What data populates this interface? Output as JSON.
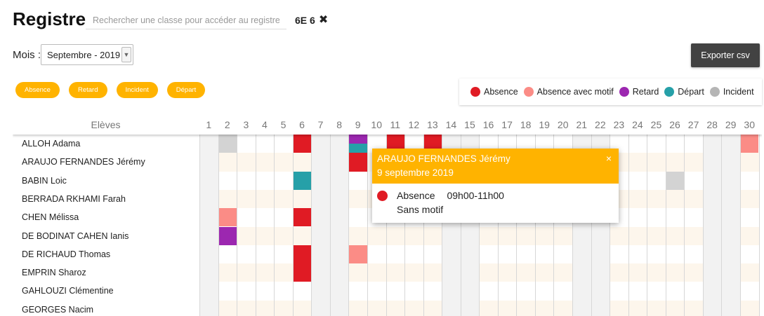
{
  "header": {
    "title": "Registre",
    "search_placeholder": "Rechercher une classe pour accéder au registre",
    "class_tag": "6E 6",
    "close_icon": "✖"
  },
  "controls": {
    "month_label": "Mois :",
    "month_value": "Septembre - 2019",
    "export_label": "Exporter csv"
  },
  "filters": [
    "Absence",
    "Retard",
    "Incident",
    "Départ"
  ],
  "colors": {
    "absence": "#e01b24",
    "absence_motif": "#fb8c86",
    "retard": "#9c27b0",
    "depart": "#26a0a8",
    "incident": "#d3d3d3",
    "accent": "#ffb300",
    "stripe": "#fdf6ec",
    "weekend": "#f2f2f2"
  },
  "legend": [
    {
      "label": "Absence",
      "color": "#e01b24"
    },
    {
      "label": "Absence avec motif",
      "color": "#fb8c86"
    },
    {
      "label": "Retard",
      "color": "#9c27b0"
    },
    {
      "label": "Départ",
      "color": "#26a0a8"
    },
    {
      "label": "Incident",
      "color": "#b5b5b5"
    }
  ],
  "grid": {
    "eleves_header": "Elèves",
    "days": [
      "1",
      "2",
      "3",
      "4",
      "5",
      "6",
      "7",
      "8",
      "9",
      "10",
      "11",
      "12",
      "13",
      "14",
      "15",
      "16",
      "17",
      "18",
      "19",
      "20",
      "21",
      "22",
      "23",
      "24",
      "25",
      "26",
      "27",
      "28",
      "29",
      "30"
    ],
    "weekend_days": [
      1,
      7,
      8,
      14,
      15,
      21,
      22,
      28,
      29
    ],
    "students": [
      "ALLOH Adama",
      "ARAUJO FERNANDES Jérémy",
      "BABIN Loic",
      "BERRADA RKHAMI Farah",
      "CHEN Mélissa",
      "DE BODINAT CAHEN Ianis",
      "DE RICHAUD Thomas",
      "EMPRIN Sharoz",
      "GAHLOUZI Clémentine",
      "GEORGES Nacim"
    ],
    "events": [
      {
        "student": 0,
        "day": 2,
        "type": "incident"
      },
      {
        "student": 0,
        "day": 6,
        "type": "absence"
      },
      {
        "student": 0,
        "day": 9,
        "type": "retard",
        "part": "top"
      },
      {
        "student": 0,
        "day": 9,
        "type": "depart",
        "part": "bottom"
      },
      {
        "student": 0,
        "day": 11,
        "type": "absence"
      },
      {
        "student": 0,
        "day": 13,
        "type": "absence"
      },
      {
        "student": 0,
        "day": 30,
        "type": "absence_motif"
      },
      {
        "student": 1,
        "day": 9,
        "type": "absence"
      },
      {
        "student": 2,
        "day": 6,
        "type": "depart"
      },
      {
        "student": 2,
        "day": 26,
        "type": "incident"
      },
      {
        "student": 4,
        "day": 2,
        "type": "absence_motif"
      },
      {
        "student": 4,
        "day": 6,
        "type": "absence"
      },
      {
        "student": 5,
        "day": 2,
        "type": "retard"
      },
      {
        "student": 6,
        "day": 6,
        "type": "absence"
      },
      {
        "student": 6,
        "day": 9,
        "type": "absence_motif"
      },
      {
        "student": 7,
        "day": 6,
        "type": "absence"
      }
    ]
  },
  "popup": {
    "name": "ARAUJO FERNANDES Jérémy",
    "date": "9 septembre 2019",
    "close": "×",
    "type": "Absence",
    "time": "09h00-11h00",
    "motif": "Sans motif"
  }
}
